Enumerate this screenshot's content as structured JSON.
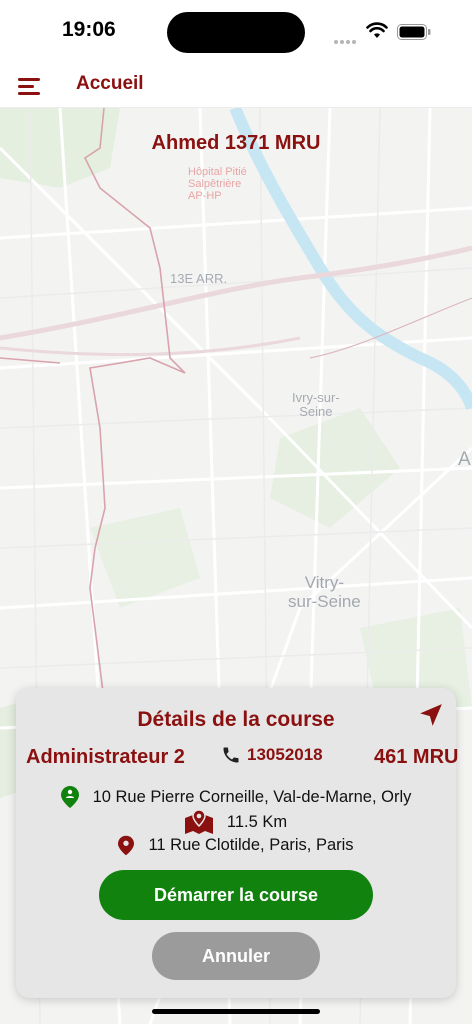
{
  "status_bar": {
    "time": "19:06"
  },
  "nav": {
    "title": "Accueil"
  },
  "map": {
    "driver_label": "Ahmed 1371 MRU",
    "labels": {
      "hospital": "Hôpital Pitié\nSalpêtrière\nAP-HP",
      "arrondissement": "13E ARR.",
      "ivry": "Ivry-sur-\nSeine",
      "vitry": "Vitry-\nsur-Seine",
      "edge_letter": "A"
    },
    "colors": {
      "background": "#f3f4f2",
      "water": "#bfe3f2",
      "park": "#dcebd6",
      "boundary": "#d8a3ad"
    }
  },
  "course": {
    "title": "Détails de la course",
    "client": "Administrateur 2",
    "phone": "13052018",
    "price": "461 MRU",
    "pickup": "10 Rue Pierre Corneille, Val-de-Marne, Orly",
    "distance": "11.5 Km",
    "dropoff": "11 Rue Clotilde, Paris, Paris",
    "start_button": "Démarrer la course",
    "cancel_button": "Annuler"
  },
  "colors": {
    "accent": "#8b1010",
    "start": "#12820f",
    "cancel": "#9b9b9b",
    "card": "#e6e6e6"
  }
}
